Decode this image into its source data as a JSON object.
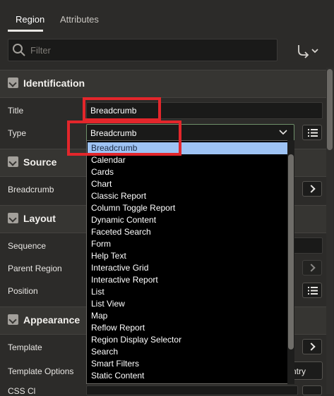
{
  "tabs": [
    {
      "label": "Region",
      "active": true
    },
    {
      "label": "Attributes",
      "active": false
    }
  ],
  "filter": {
    "placeholder": "Filter"
  },
  "sections": {
    "identification": {
      "title": "Identification",
      "title_label": "Title",
      "title_value": "Breadcrumb",
      "type_label": "Type",
      "type_value": "Breadcrumb"
    },
    "source": {
      "title": "Source",
      "field_label": "Breadcrumb"
    },
    "layout": {
      "title": "Layout",
      "sequence_label": "Sequence",
      "parent_label": "Parent Region",
      "position_label": "Position"
    },
    "appearance": {
      "title": "Appearance",
      "template_label": "Template",
      "template_options_label": "Template Options",
      "template_options_button_partial": "ntry",
      "css_label_partial": "CSS Cl"
    }
  },
  "dropdown": {
    "options": [
      "Breadcrumb",
      "Calendar",
      "Cards",
      "Chart",
      "Classic Report",
      "Column Toggle Report",
      "Dynamic Content",
      "Faceted Search",
      "Form",
      "Help Text",
      "Interactive Grid",
      "Interactive Report",
      "List",
      "List View",
      "Map",
      "Reflow Report",
      "Region Display Selector",
      "Search",
      "Smart Filters",
      "Static Content"
    ],
    "selected_index": 0
  },
  "colors": {
    "highlight": "#e3262b",
    "selected_option": "#9ec3f4",
    "background": "#2c2b29"
  }
}
